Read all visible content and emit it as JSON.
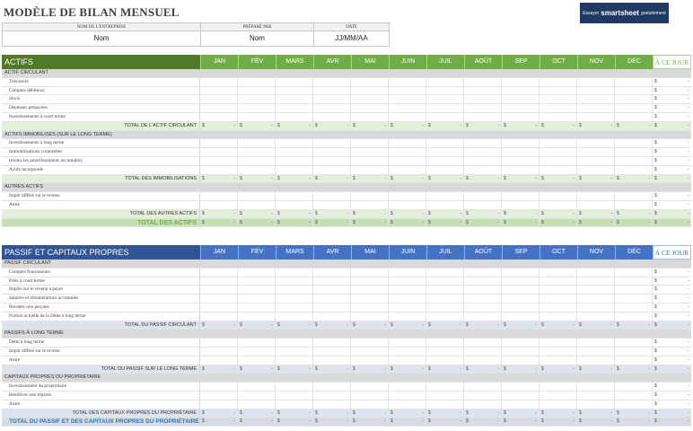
{
  "title": "MODÈLE DE BILAN MENSUEL",
  "info": {
    "company_label": "NOM DE L'ENTREPRISE",
    "company_value": "Nom",
    "prepared_label": "PRÉPARÉ PAR",
    "prepared_value": "Nom",
    "date_label": "DATE",
    "date_value": "JJ/MM/AA"
  },
  "ad": {
    "prefix": "Essayer",
    "brand": "smartsheet",
    "suffix": "gratuitement"
  },
  "months": [
    "JAN",
    "FÉV",
    "MARS",
    "AVR",
    "MAI",
    "JUIN",
    "JUIL",
    "AOÛT",
    "SEP",
    "OCT",
    "NOV",
    "DÉC"
  ],
  "ytd_label": "À CE JOUR",
  "currency": "$",
  "empty_value": "-",
  "colors": {
    "assets_accent": "#70ad47",
    "liabilities_accent": "#4472c4"
  },
  "assets": {
    "title": "ACTIFS",
    "rows": [
      {
        "kind": "cat",
        "label": "ACTIF CIRCULANT"
      },
      {
        "kind": "item",
        "label": "Trésorerie"
      },
      {
        "kind": "item",
        "label": "Comptes débiteurs"
      },
      {
        "kind": "item",
        "label": "Stock"
      },
      {
        "kind": "item",
        "label": "Dépenses prépayées"
      },
      {
        "kind": "item",
        "label": "Investissements à court terme"
      },
      {
        "kind": "tot",
        "label": "TOTAL DE L'ACTIF CIRCULANT"
      },
      {
        "kind": "cat",
        "label": "ACTIFS IMMOBILISÉS (SUR LE LONG TERME)"
      },
      {
        "kind": "item",
        "label": "Investissements à long terme"
      },
      {
        "kind": "item",
        "label": "Immobilisations corporelles"
      },
      {
        "kind": "item",
        "label": "(moins les amortissements accumulés)"
      },
      {
        "kind": "item",
        "label": "Actifs incorporels"
      },
      {
        "kind": "tot",
        "label": "TOTAL DES IMMOBILISATIONS"
      },
      {
        "kind": "cat",
        "label": "AUTRES ACTIFS"
      },
      {
        "kind": "item",
        "label": "Impôt différé sur le revenu"
      },
      {
        "kind": "item",
        "label": "Autre"
      },
      {
        "kind": "tot",
        "label": "TOTAL DES AUTRES ACTIFS"
      },
      {
        "kind": "grand",
        "label": "TOTAL DES ACTIFS"
      }
    ]
  },
  "liabilities": {
    "title": "PASSIF ET CAPITAUX PROPRES",
    "rows": [
      {
        "kind": "cat",
        "label": "PASSIF CIRCULANT"
      },
      {
        "kind": "item",
        "label": "Comptes fournisseurs"
      },
      {
        "kind": "item",
        "label": "Prêts à court terme"
      },
      {
        "kind": "item",
        "label": "Impôts sur le revenu à payer"
      },
      {
        "kind": "item",
        "label": "Salaires et rémunérations accumulés"
      },
      {
        "kind": "item",
        "label": "Recettes non perçues"
      },
      {
        "kind": "item",
        "label": "Portion actuelle de la Dette à long terme"
      },
      {
        "kind": "tot",
        "label": "TOTAL DU PASSIF CIRCULANT"
      },
      {
        "kind": "cat",
        "label": "PASSIFS À LONG TERME"
      },
      {
        "kind": "item",
        "label": "Dette à long terme"
      },
      {
        "kind": "item",
        "label": "Impôt différé sur le revenu"
      },
      {
        "kind": "item",
        "label": "Autre"
      },
      {
        "kind": "tot",
        "label": "TOTAL DU PASSIF SUR LE LONG TERME"
      },
      {
        "kind": "cat",
        "label": "CAPITAUX PROPRES DU PROPRIÉTAIRE"
      },
      {
        "kind": "item",
        "label": "Investissement du propriétaire"
      },
      {
        "kind": "item",
        "label": "Bénéfices non répartis"
      },
      {
        "kind": "item",
        "label": "Autre"
      },
      {
        "kind": "tot",
        "label": "TOTAL DES CAPITAUX PROPRES DU PROPRIÉTAIRE"
      },
      {
        "kind": "grand",
        "label": "TOTAL DU PASSIF ET DES CAPITAUX PROPRES DU PROPRIÉTAIRE"
      }
    ]
  }
}
